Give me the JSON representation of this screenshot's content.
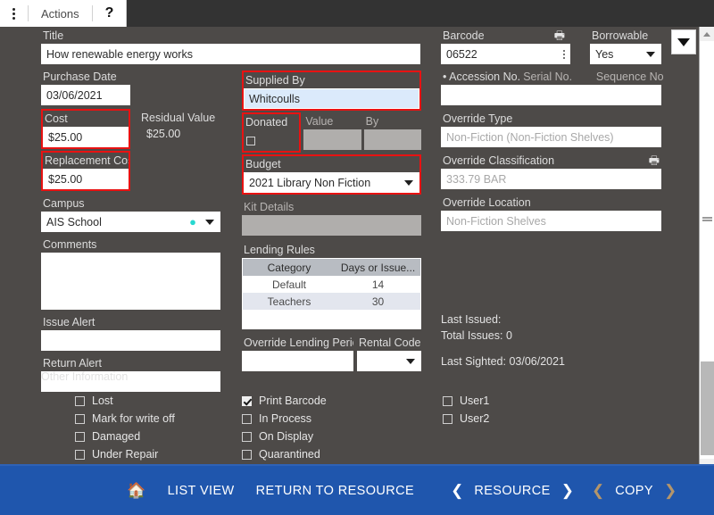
{
  "toolbar": {
    "menu_icon": "kebab-menu-icon",
    "actions_label": "Actions",
    "help_label": "?"
  },
  "collapse_button": {
    "icon": "chevron-down-icon"
  },
  "left_column": {
    "title_label": "Title",
    "title_value": "How renewable energy works",
    "purchase_date_label": "Purchase Date",
    "purchase_date_value": "03/06/2021",
    "cost_label": "Cost",
    "cost_value": "$25.00",
    "residual_value_label": "Residual Value",
    "residual_value_value": "$25.00",
    "replacement_cost_label": "Replacement Cost",
    "replacement_cost_value": "$25.00",
    "campus_label": "Campus",
    "campus_value": "AIS School",
    "comments_label": "Comments",
    "comments_value": "",
    "issue_alert_label": "Issue Alert",
    "issue_alert_value": "",
    "return_alert_label": "Return Alert",
    "return_alert_value": ""
  },
  "middle_column": {
    "supplied_by_label": "Supplied By",
    "supplied_by_value": "Whitcoulls",
    "donated_label": "Donated",
    "value_label": "Value",
    "by_label": "By",
    "donated_checked": false,
    "budget_label": "Budget",
    "budget_value": "2021 Library Non Fiction",
    "kit_details_label": "Kit Details",
    "kit_details_value": "",
    "lending_rules_label": "Lending Rules",
    "lending_rules_columns": [
      "Category",
      "Days or Issue..."
    ],
    "lending_rules_rows": [
      {
        "category": "Default",
        "days": "14"
      },
      {
        "category": "Teachers",
        "days": "30"
      }
    ],
    "override_lending_label": "Override Lending Perio",
    "override_lending_value": "",
    "rental_code_label": "Rental Code",
    "rental_code_value": ""
  },
  "right_column": {
    "barcode_label": "Barcode",
    "barcode_print_icon": "printer-icon",
    "barcode_value": "06522",
    "borrowable_label": "Borrowable",
    "borrowable_value": "Yes",
    "accession_no_label": "• Accession No.",
    "serial_no_label": "Serial No.",
    "sequence_no_label": "Sequence No.",
    "accession_value": "",
    "override_type_label": "Override Type",
    "override_type_placeholder": "Non-Fiction (Non-Fiction Shelves)",
    "override_classification_label": "Override Classification",
    "override_classification_print_icon": "printer-icon",
    "override_classification_placeholder": "333.79 BAR",
    "override_location_label": "Override Location",
    "override_location_placeholder": "Non-Fiction Shelves",
    "last_issued_text": "Last Issued:",
    "total_issues_text": "Total Issues: 0",
    "last_sighted_text": "Last Sighted: 03/06/2021"
  },
  "other_information": {
    "title": "Other Information",
    "column1": [
      {
        "label": "Lost",
        "checked": false
      },
      {
        "label": "Mark for write off",
        "checked": false
      },
      {
        "label": "Damaged",
        "checked": false
      },
      {
        "label": "Under Repair",
        "checked": false
      }
    ],
    "column2": [
      {
        "label": "Print Barcode",
        "checked": true
      },
      {
        "label": "In Process",
        "checked": false
      },
      {
        "label": "On Display",
        "checked": false
      },
      {
        "label": "Quarantined",
        "checked": false
      }
    ],
    "column3": [
      {
        "label": "User1",
        "checked": false
      },
      {
        "label": "User2",
        "checked": false
      }
    ]
  },
  "bottom_bar": {
    "home_icon": "home-icon",
    "list_view_label": "LIST VIEW",
    "return_to_resource_label": "RETURN TO RESOURCE",
    "resource_prev_icon": "chevron-left-icon",
    "resource_label": "RESOURCE",
    "resource_next_icon": "chevron-right-icon",
    "copy_prev_icon": "chevron-left-icon",
    "copy_label": "COPY",
    "copy_next_icon": "chevron-right-icon"
  },
  "colors": {
    "background": "#4d4a48",
    "bottom_bar": "#1f56ad",
    "highlight_outline": "#e81212",
    "focus_field": "#dbeafb",
    "pin_accent": "#27d8d0"
  }
}
